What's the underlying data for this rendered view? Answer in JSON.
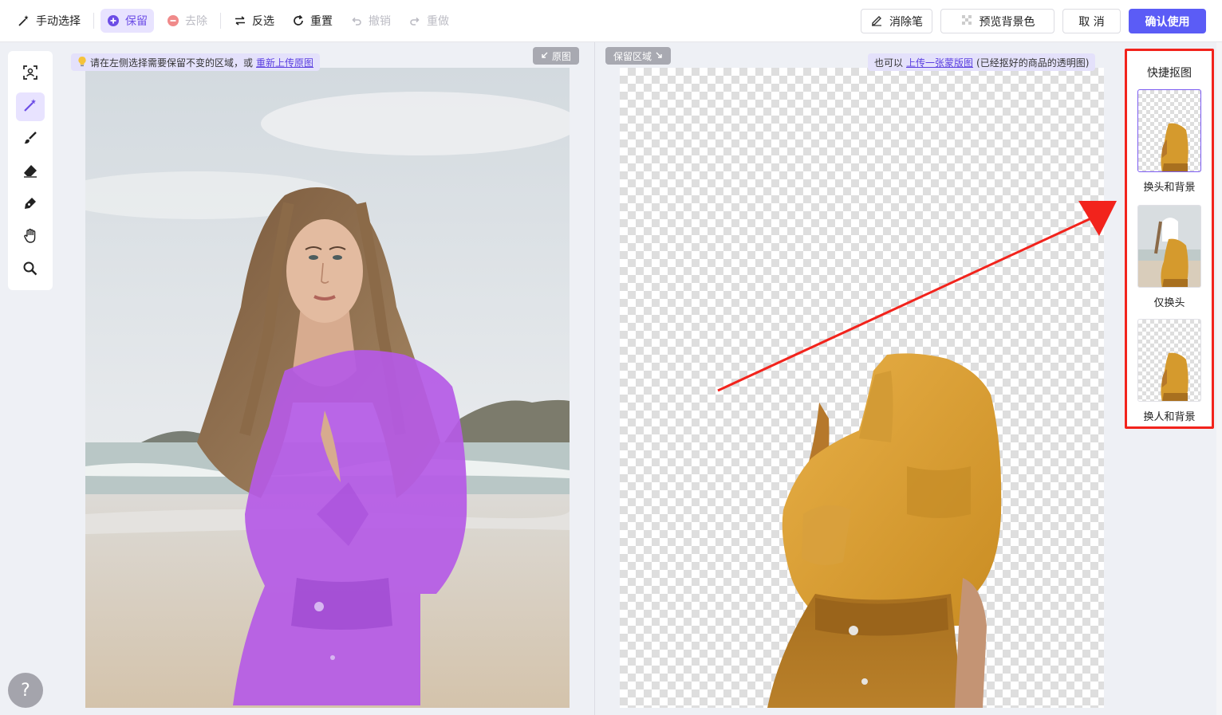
{
  "toolbar": {
    "mode_label": "手动选择",
    "keep_label": "保留",
    "remove_label": "去除",
    "invert_label": "反选",
    "reset_label": "重置",
    "undo_label": "撤销",
    "redo_label": "重做",
    "eraser_pen_label": "消除笔",
    "preview_bg_label": "预览背景色",
    "cancel_label": "取 消",
    "confirm_label": "确认使用"
  },
  "tools": [
    "scan-select-icon",
    "magic-wand-icon",
    "brush-icon",
    "eraser-icon",
    "pen-icon",
    "hand-icon",
    "zoom-icon"
  ],
  "left_panel": {
    "hint_text": "请在左侧选择需要保留不变的区域，或",
    "hint_link": "重新上传原图",
    "tag_label": "原图"
  },
  "right_panel": {
    "tag_label": "保留区域",
    "hint_prefix": "也可以",
    "hint_link": "上传一张蒙版图",
    "hint_suffix": "(已经抠好的商品的透明图)"
  },
  "quick_cutout": {
    "title": "快捷抠图",
    "options": [
      {
        "label": "换头和背景",
        "selected": true
      },
      {
        "label": "仅换头",
        "selected": false
      },
      {
        "label": "换人和背景",
        "selected": false
      }
    ]
  },
  "help_label": "?",
  "colors": {
    "accent": "#5b5cf6",
    "selection_overlay": "#b55ae6",
    "highlight_box": "#f2231c",
    "dress": "#d59a2d"
  }
}
